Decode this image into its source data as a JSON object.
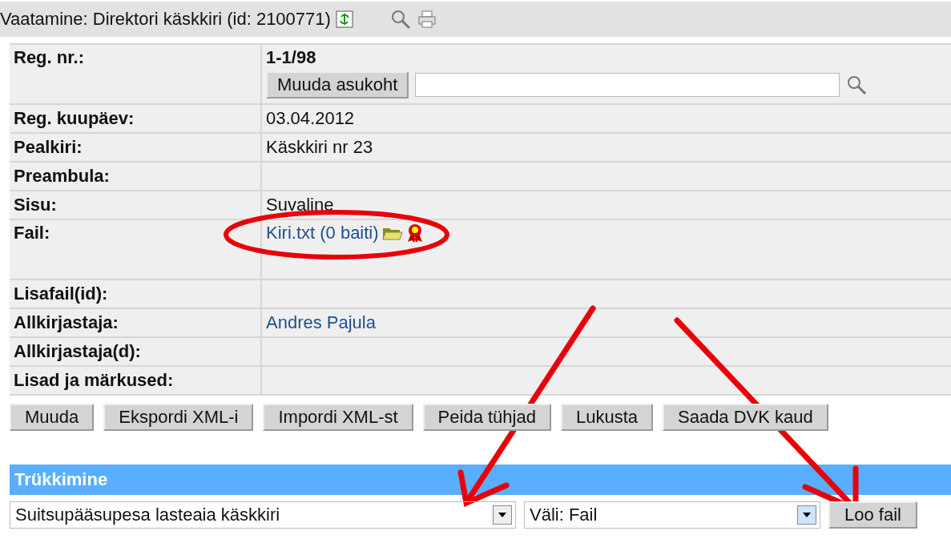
{
  "title": "Vaatamine: Direktori käskkiri (id: 2100771)",
  "fields": [
    {
      "kind": "reg",
      "label": "Reg. nr.:",
      "value": "1-1/98",
      "button": "Muuda asukoht"
    },
    {
      "kind": "text",
      "label": "Reg. kuupäev:",
      "value": "03.04.2012"
    },
    {
      "kind": "text",
      "label": "Pealkiri:",
      "value": "Käskkiri nr 23"
    },
    {
      "kind": "text",
      "label": "Preambula:"
    },
    {
      "kind": "text",
      "label": "Sisu:",
      "value": "Suvaline"
    },
    {
      "kind": "file",
      "label": "Fail:",
      "value": "Kiri.txt (0 baiti)"
    },
    {
      "kind": "text",
      "label": "Lisafail(id):"
    },
    {
      "kind": "link",
      "label": "Allkirjastaja:",
      "value": "Andres Pajula"
    },
    {
      "kind": "text",
      "label": "Allkirjastaja(d):"
    },
    {
      "kind": "text",
      "label": "Lisad ja märkused:"
    }
  ],
  "actions": [
    "Muuda",
    "Ekspordi XML-i",
    "Impordi XML-st",
    "Peida tühjad",
    "Lukusta",
    "Saada DVK kaud"
  ],
  "print": {
    "header": "Trükkimine",
    "template": "Suitsupääsupesa lasteaia käskkiri",
    "format": "Väli: Fail",
    "button": "Loo fail"
  }
}
